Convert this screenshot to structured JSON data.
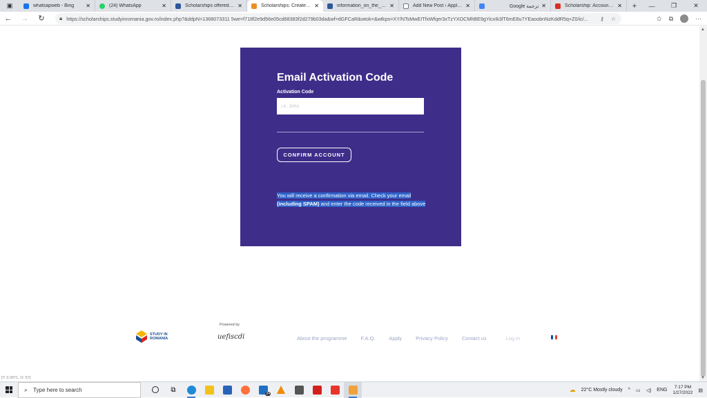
{
  "browser": {
    "tabs": [
      {
        "label": "whatsapweb - Bing",
        "icon": "bing-icon",
        "color": "#1a73e8",
        "active": false
      },
      {
        "label": "(24) WhatsApp",
        "icon": "whatsapp-icon",
        "color": "#25d366",
        "active": false
      },
      {
        "label": "Scholarships offered by th",
        "icon": "site-icon",
        "color": "#2b5797",
        "active": false
      },
      {
        "label": "Scholarships: Create Accou",
        "icon": "site-icon",
        "color": "#e9902a",
        "active": true
      },
      {
        "label": "information_on_the_schola",
        "icon": "word-icon",
        "color": "#2b579a",
        "active": false
      },
      {
        "label": "Add New Post ‹ Applyen —",
        "icon": "doc-icon",
        "color": "#777777",
        "active": false
      },
      {
        "label": "Google ترجمة",
        "icon": "translate-icon",
        "color": "#4285f4",
        "active": false
      },
      {
        "label": "Scholarship: Account activ",
        "icon": "gmail-icon",
        "color": "#d93025",
        "active": false
      }
    ],
    "url": "https://scholarships.studyinromania.gov.ro/index.php?&ddpN=1368073311 5we=f718f2e9d56e05cd68383f2d279b03da&wf=dGFCaR&wtok=&wtkps=XY/NTsMwEITfxWfqer3xTzYXOCMhBE9gYicxIk3lT6mE8u7YEaoobnNzKddR5q+Z0/ic/..."
  },
  "card": {
    "title": "Email Activation Code",
    "field_label": "Activation Code",
    "field_placeholder": "i.e. John",
    "confirm_label": "CONFIRM ACCOUNT",
    "notice_part1": "You will receive a confirmation via email. Check your email",
    "notice_bold": "(including SPAM)",
    "notice_part2": " and enter the code received in the field above"
  },
  "footer": {
    "logo_line1": "STUDY IN",
    "logo_line2": "ROMANIA",
    "powered_by": "Powered by",
    "fiscedi": "uefiscdi",
    "nav": [
      "About the programme",
      "F.A.Q.",
      "Apply",
      "Privacy Policy",
      "Contact us"
    ],
    "login": "Log in"
  },
  "status_text": "[T: 0.3971, O: 57]",
  "taskbar": {
    "search_placeholder": "Type here to search",
    "weather": "22°C  Mostly cloudy",
    "lang": "ENG",
    "time": "7:17 PM",
    "date": "1/27/2022",
    "badge": "24"
  },
  "colors": {
    "card_bg": "#3f2d8a",
    "selection": "#2f63c9",
    "footer_link": "#9aa6c4"
  }
}
